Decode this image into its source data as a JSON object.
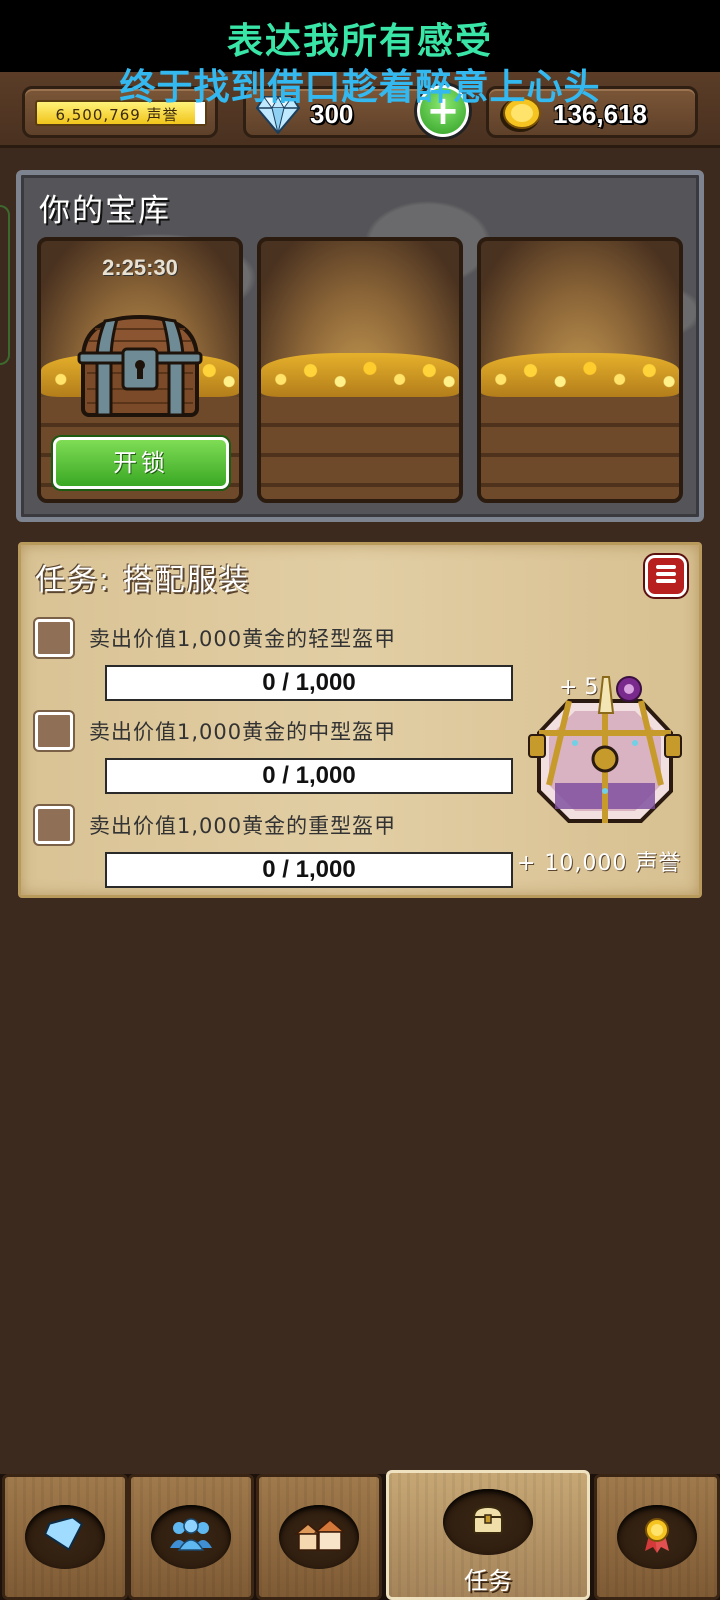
{
  "overlay": {
    "lyric_line1": "表达我所有感受",
    "lyric_line2": "终于找到借口趁着醉意上心头",
    "colors": {
      "line1": "#39e6a8",
      "line2": "#34b8f0"
    }
  },
  "currency": {
    "reputation": "6,500,769 声誉",
    "gems": "300",
    "gold": "136,618",
    "icons": [
      "diamond-icon",
      "plus-icon",
      "gold-coin-icon"
    ]
  },
  "vault": {
    "title": "你的宝库",
    "slots": [
      {
        "timer": "2:25:30",
        "button": "开锁",
        "state": "locked-chest"
      },
      {
        "state": "empty"
      },
      {
        "state": "empty"
      }
    ]
  },
  "quest": {
    "title": "任务: 搭配服装",
    "tasks": [
      {
        "label": "卖出价值1,000黄金的轻型盔甲",
        "progress": "0 / 1,000",
        "done": false
      },
      {
        "label": "卖出价值1,000黄金的中型盔甲",
        "progress": "0 / 1,000",
        "done": false
      },
      {
        "label": "卖出价值1,000黄金的重型盔甲",
        "progress": "0 / 1,000",
        "done": false
      }
    ],
    "reward": {
      "count": "+ 5",
      "reputation": "+ 10,000 声誉"
    }
  },
  "nav": {
    "tabs": [
      {
        "icon": "diamond-icon",
        "label": ""
      },
      {
        "icon": "people-icon",
        "label": ""
      },
      {
        "icon": "house-icon",
        "label": ""
      },
      {
        "icon": "chest-icon",
        "label": "任务",
        "active": true
      },
      {
        "icon": "medal-icon",
        "label": ""
      }
    ]
  }
}
